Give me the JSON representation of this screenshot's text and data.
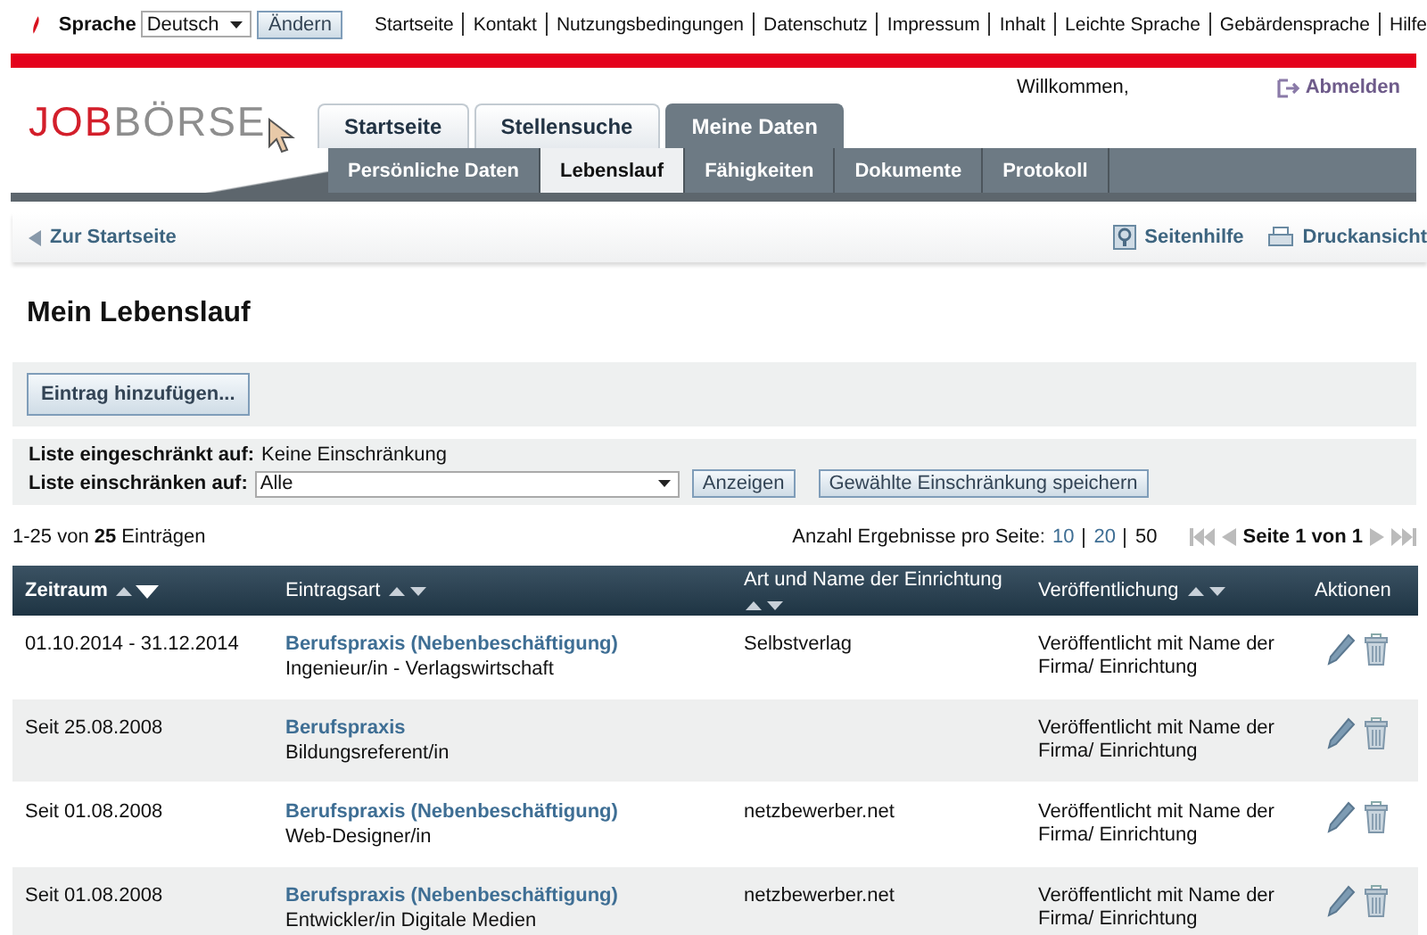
{
  "top_bar": {
    "language_label": "Sprache",
    "language_value": "Deutsch",
    "change_button": "Ändern",
    "links": [
      "Startseite",
      "Kontakt",
      "Nutzungsbedingungen",
      "Datenschutz",
      "Impressum",
      "Inhalt",
      "Leichte Sprache",
      "Gebärdensprache",
      "Hilfe"
    ]
  },
  "header": {
    "logo": {
      "part_1": "JOB",
      "part_2": "BÖRSE"
    },
    "welcome": "Willkommen,",
    "logout": "Abmelden",
    "main_tabs": [
      {
        "label": "Startseite",
        "selected": false
      },
      {
        "label": "Stellensuche",
        "selected": false
      },
      {
        "label": "Meine Daten",
        "selected": true
      }
    ],
    "sub_tabs": [
      {
        "label": "Persönliche Daten",
        "selected": false
      },
      {
        "label": "Lebenslauf",
        "selected": true
      },
      {
        "label": "Fähigkeiten",
        "selected": false
      },
      {
        "label": "Dokumente",
        "selected": false
      },
      {
        "label": "Protokoll",
        "selected": false
      }
    ]
  },
  "breadcrumb": {
    "back_link": "Zur Startseite",
    "help_link": "Seitenhilfe",
    "print_link": "Druckansicht"
  },
  "page_title": "Mein Lebenslauf",
  "add_button": "Eintrag hinzufügen...",
  "filter": {
    "restricted_label": "Liste eingeschränkt auf:",
    "restricted_value": "Keine Einschränkung",
    "restrict_label": "Liste einschränken auf:",
    "restrict_value": "Alle",
    "show_button": "Anzeigen",
    "save_button": "Gewählte Einschränkung speichern"
  },
  "results": {
    "count": "1-25 von **25** Einträgen",
    "per_page_label": "Anzahl Ergebnisse pro Seite:",
    "per_page_options": [
      {
        "label": "10",
        "selected": false
      },
      {
        "label": "20",
        "selected": false
      },
      {
        "label": "50",
        "selected": true
      }
    ],
    "page_info": "Seite 1 von 1"
  },
  "table": {
    "columns": [
      {
        "label": "Zeitraum",
        "sorted": true
      },
      {
        "label": "Eintragsart",
        "sorted": false
      },
      {
        "label": "Art und Name der Einrichtung",
        "sorted": false
      },
      {
        "label": "Veröffentlichung",
        "sorted": false
      },
      {
        "label": "Aktionen"
      }
    ],
    "rows": [
      {
        "period": "01.10.2014 - 31.12.2014",
        "type": "Berufspraxis (Nebenbeschäftigung)",
        "job": "Ingenieur/in - Verlagswirtschaft",
        "institution": "Selbstverlag",
        "publication": "Veröffentlicht mit Name der Firma/ Einrichtung"
      },
      {
        "period": "Seit 25.08.2008",
        "type": "Berufspraxis",
        "job": "Bildungsreferent/in",
        "publication": "Veröffentlicht mit Name der Firma/ Einrichtung"
      },
      {
        "period": "Seit 01.08.2008",
        "type": "Berufspraxis (Nebenbeschäftigung)",
        "job": "Web-Designer/in",
        "institution": "netzbewerber.net",
        "publication": "Veröffentlicht mit Name der Firma/ Einrichtung"
      },
      {
        "period": "Seit 01.08.2008",
        "type": "Berufspraxis (Nebenbeschäftigung)",
        "job": "Entwickler/in Digitale Medien",
        "institution": "netzbewerber.net",
        "publication": "Veröffentlicht mit Name der Firma/ Einrichtung"
      }
    ]
  }
}
